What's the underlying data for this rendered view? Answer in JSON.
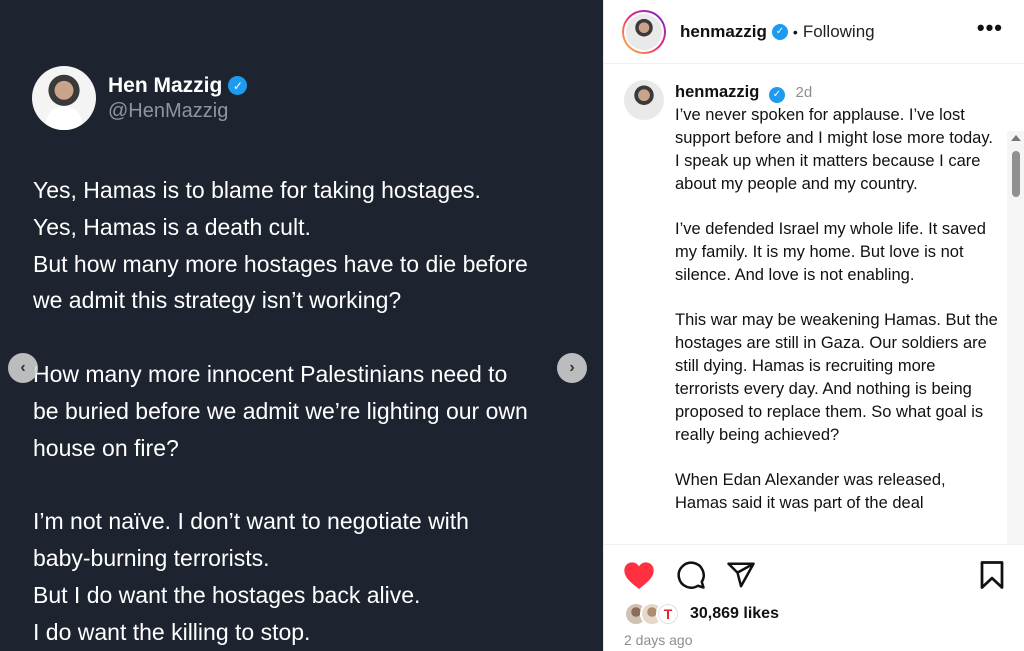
{
  "tweet": {
    "display_name": "Hen Mazzig",
    "handle": "@HenMazzig",
    "verified_mark": "✓",
    "lines": [
      "Yes, Hamas is to blame for taking hostages.",
      "Yes, Hamas is a death cult.",
      "But how many more hostages have to die before",
      "we admit this strategy isn’t working?",
      "",
      "How many more innocent Palestinians need to",
      "be buried before we admit we’re lighting our own",
      "house on fire?",
      "",
      "I’m not naïve. I don’t want to negotiate with",
      "baby-burning terrorists.",
      "But I do want the hostages back alive.",
      "I do want the killing to stop."
    ]
  },
  "carousel": {
    "prev_icon": "chevron-left-icon",
    "next_icon": "chevron-right-icon",
    "prev_glyph": "‹",
    "next_glyph": "›"
  },
  "header": {
    "username": "henmazzig",
    "verified_mark": "✓",
    "separator": "•",
    "follow_status": "Following",
    "more_glyph": "•••"
  },
  "caption": {
    "username": "henmazzig",
    "verified_mark": "✓",
    "time": "2d",
    "paragraphs": [
      "I’ve never spoken for applause. I’ve lost support before and I might lose more today. I speak up when it matters because I care about my people and my country.",
      "I’ve defended Israel my whole life. It saved my family. It is my home. But love is not silence. And love is not enabling.",
      "This war may be weakening Hamas. But the hostages are still in Gaza. Our soldiers are still dying. Hamas is recruiting more terrorists every day. And nothing is being proposed to replace them. So what goal is really being achieved?",
      "When Edan Alexander was released, Hamas said it was part of the deal"
    ]
  },
  "actions": {
    "like_icon": "heart-icon",
    "comment_icon": "comment-icon",
    "share_icon": "share-icon",
    "save_icon": "bookmark-icon",
    "like_color": "#ff3040"
  },
  "likes": {
    "count_text": "30,869 likes",
    "liker_badge": "T"
  },
  "posted": {
    "relative": "2 days ago"
  },
  "colors": {
    "media_bg": "#1d2430",
    "verified": "#1d9bf0",
    "muted": "#8e8e8e"
  }
}
